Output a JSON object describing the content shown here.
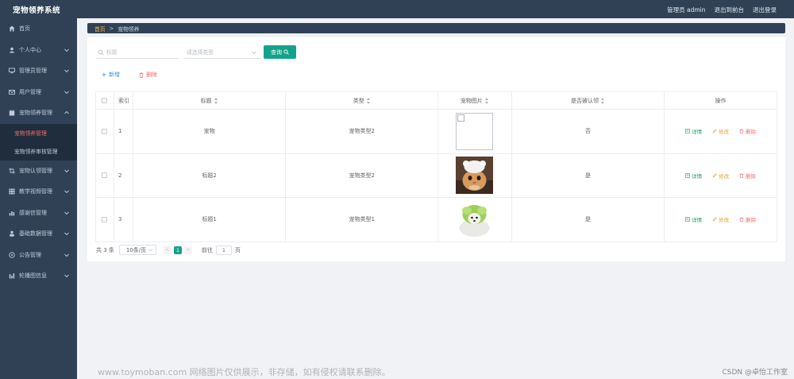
{
  "header": {
    "title": "宠物领养系统",
    "user": "管理员 admin",
    "back_to_front": "退出到前台",
    "logout": "退出登录"
  },
  "sidebar": {
    "items": [
      {
        "label": "首页",
        "icon": "home-icon"
      },
      {
        "label": "个人中心",
        "icon": "user-icon"
      },
      {
        "label": "管理员管理",
        "icon": "monitor-icon"
      },
      {
        "label": "用户管理",
        "icon": "mail-icon"
      },
      {
        "label": "宠物领养管理",
        "icon": "calendar-icon",
        "open": true,
        "children": [
          {
            "label": "宠物领养管理",
            "active": true
          },
          {
            "label": "宠物领养审核管理",
            "active": false
          }
        ]
      },
      {
        "label": "宠物认领管理",
        "icon": "crop-icon"
      },
      {
        "label": "教学视频管理",
        "icon": "grid-icon"
      },
      {
        "label": "感谢信管理",
        "icon": "chart-icon"
      },
      {
        "label": "基础数据管理",
        "icon": "person-icon"
      },
      {
        "label": "公告管理",
        "icon": "bell-icon"
      },
      {
        "label": "轮播图信息",
        "icon": "bar-icon"
      }
    ]
  },
  "breadcrumb": {
    "home": "首页",
    "separator": ">",
    "current": "宠物领养"
  },
  "search": {
    "title_placeholder": "标题",
    "type_placeholder": "请选择类型",
    "query_button": "查询"
  },
  "actions": {
    "add": "新增",
    "delete": "删除"
  },
  "table": {
    "headers": {
      "index": "索引",
      "title": "标题",
      "type": "类型",
      "image": "宠物图片",
      "confirmed": "是否被认领",
      "ops": "操作"
    },
    "rows": [
      {
        "index": "1",
        "title": "宠物",
        "type": "宠物类型2",
        "image": "broken",
        "confirmed": "否"
      },
      {
        "index": "2",
        "title": "标题2",
        "type": "宠物类型2",
        "image": "cat",
        "confirmed": "是"
      },
      {
        "index": "3",
        "title": "标题1",
        "type": "宠物类型1",
        "image": "dog",
        "confirmed": "是"
      }
    ],
    "op_labels": {
      "detail": "详情",
      "edit": "修改",
      "remove": "删除"
    }
  },
  "pagination": {
    "total": "共 3 条",
    "page_size": "10条/页",
    "current_page": "1",
    "goto_label": "前往",
    "goto_value": "1",
    "page_suffix": "页"
  },
  "watermark": {
    "left": "www.toymoban.com 网络图片仅供展示，非存储，如有侵权请联系删除。",
    "right": "CSDN @卓怡工作室"
  },
  "colors": {
    "topbar": "#304156",
    "accent_green": "#13a38a",
    "active_red": "#f56c6c",
    "link_blue": "#3a8ee6",
    "edit_orange": "#e6a23c"
  }
}
